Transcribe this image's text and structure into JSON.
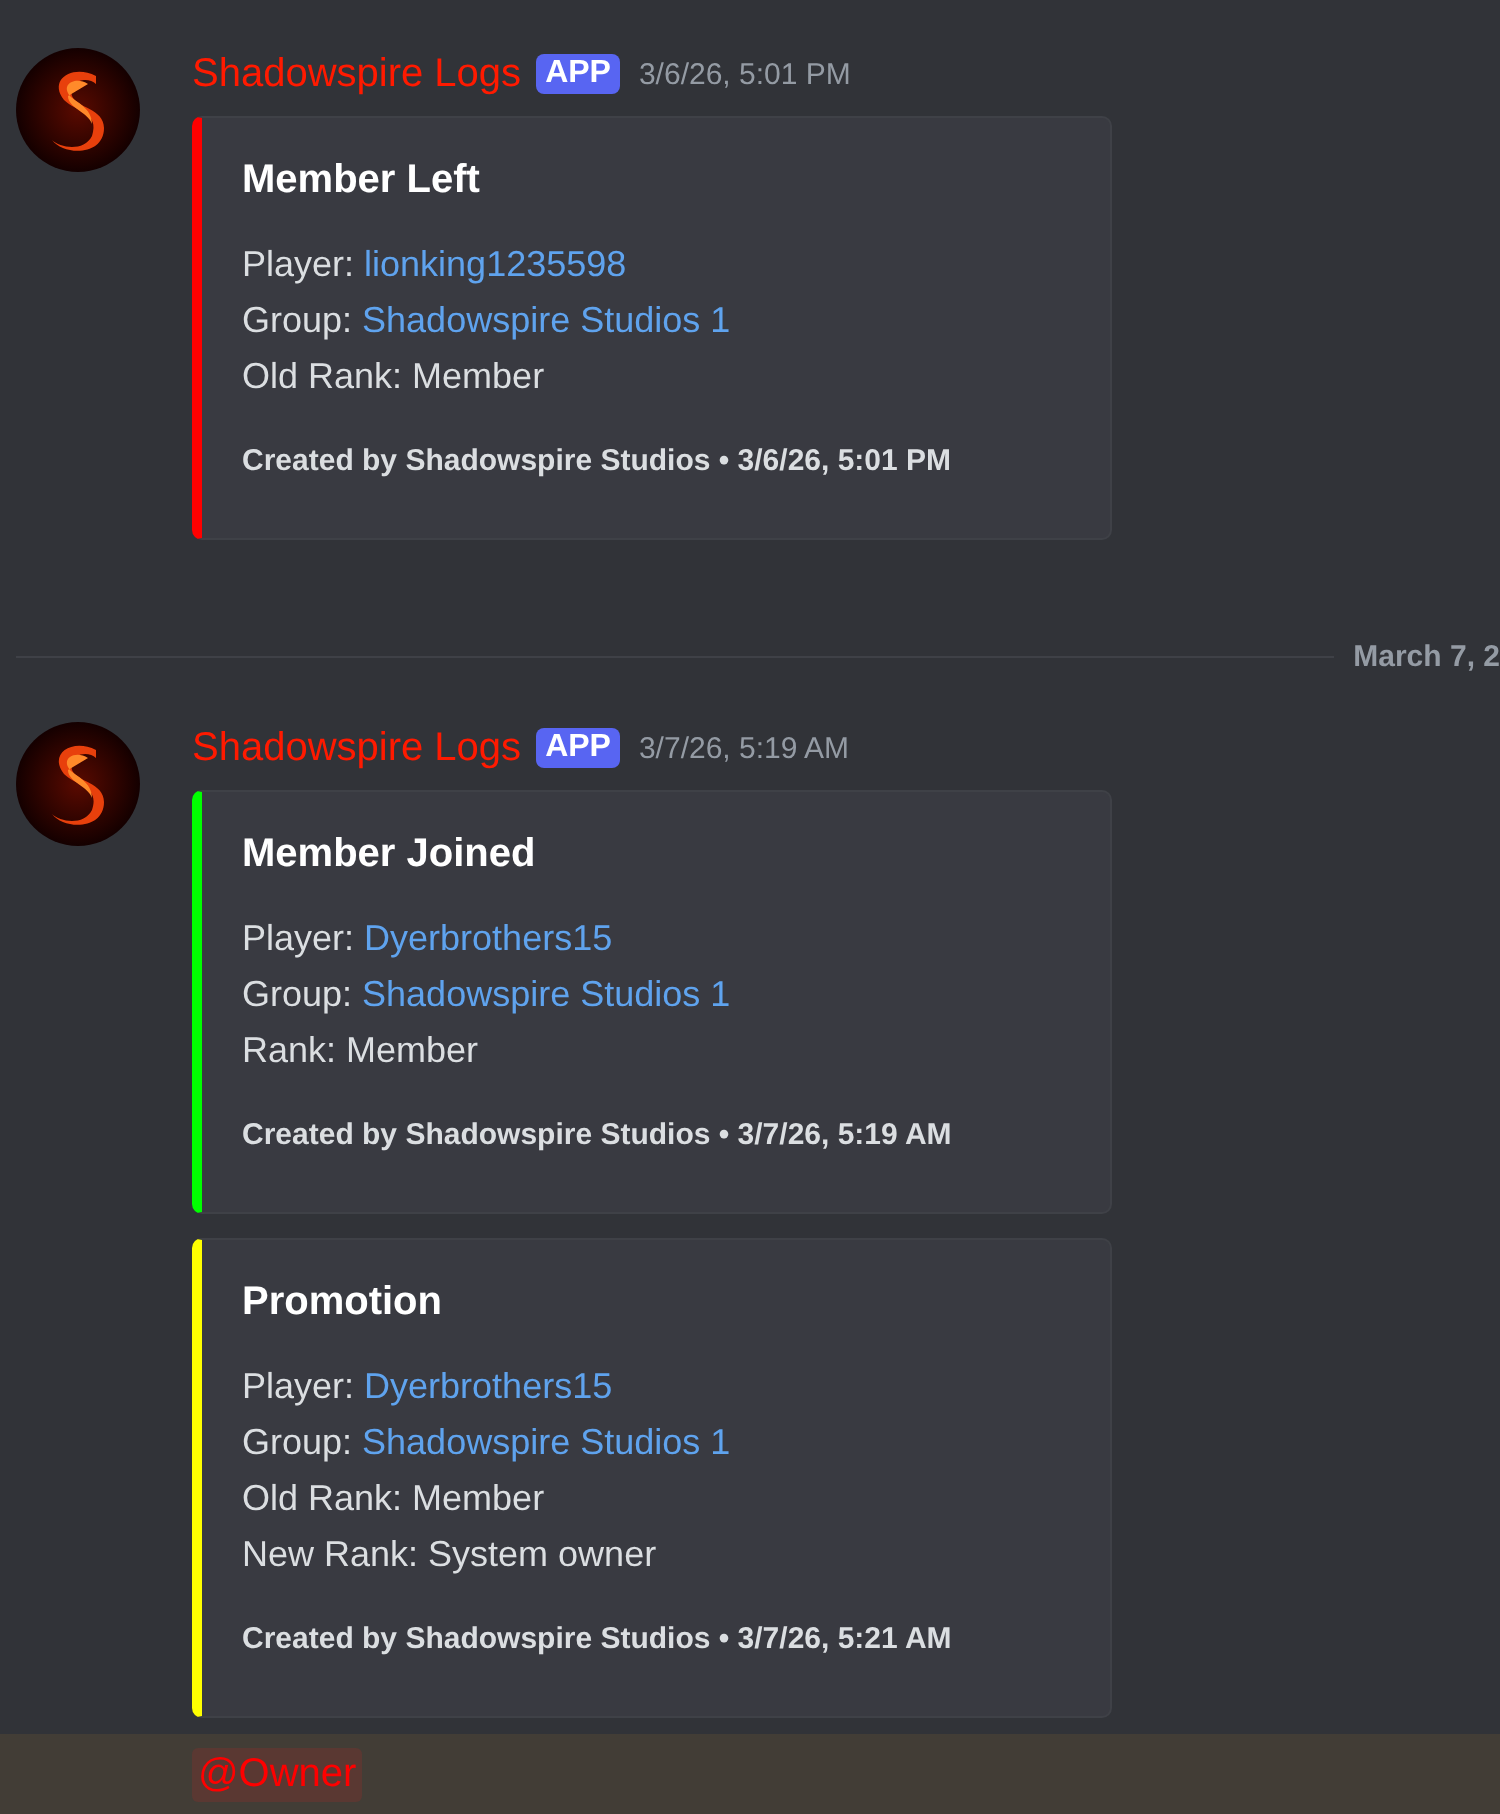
{
  "messages": [
    {
      "author": "Shadowspire Logs",
      "badge": "APP",
      "time": "3/6/26, 5:01 PM",
      "embeds": [
        {
          "color": "#ff0000",
          "title": "Member Left",
          "fields": [
            {
              "label": "Player:",
              "value": "lionking1235598",
              "link": true
            },
            {
              "label": "Group:",
              "value": "Shadowspire Studios 1",
              "link": true
            },
            {
              "label": "Old Rank:",
              "value": "Member",
              "link": false
            }
          ],
          "footer": "Created by Shadowspire Studios • 3/6/26, 5:01 PM"
        }
      ]
    },
    {
      "divider": "March 7, 2",
      "author": "Shadowspire Logs",
      "badge": "APP",
      "time": "3/7/26, 5:19 AM",
      "embeds": [
        {
          "color": "#00ff00",
          "title": "Member Joined",
          "fields": [
            {
              "label": "Player:",
              "value": "Dyerbrothers15",
              "link": true
            },
            {
              "label": "Group:",
              "value": "Shadowspire Studios 1",
              "link": true
            },
            {
              "label": "Rank:",
              "value": "Member",
              "link": false
            }
          ],
          "footer": "Created by Shadowspire Studios • 3/7/26, 5:19 AM"
        },
        {
          "color": "#ffff00",
          "title": "Promotion",
          "fields": [
            {
              "label": "Player:",
              "value": "Dyerbrothers15",
              "link": true
            },
            {
              "label": "Group:",
              "value": "Shadowspire Studios 1",
              "link": true
            },
            {
              "label": "Old Rank:",
              "value": "Member",
              "link": false
            },
            {
              "label": "New Rank:",
              "value": "System owner",
              "link": false
            }
          ],
          "footer": "Created by Shadowspire Studios • 3/7/26, 5:21 AM"
        }
      ],
      "mention": "@Owner"
    }
  ]
}
